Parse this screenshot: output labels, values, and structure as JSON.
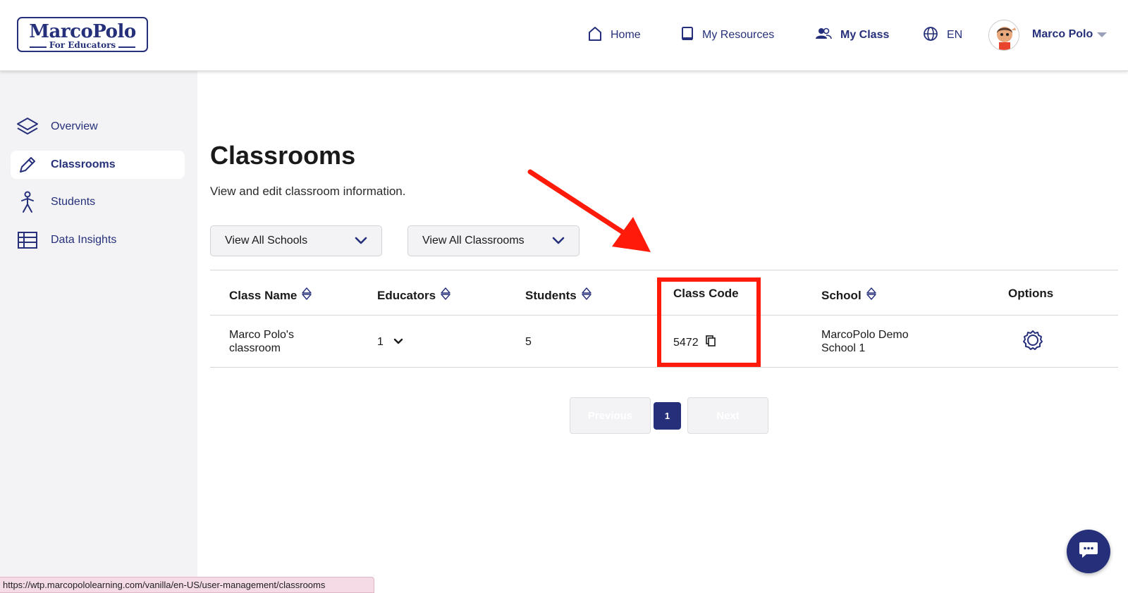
{
  "header": {
    "logo_text": "MarcoPolo",
    "logo_subtext": "For Educators",
    "nav": [
      {
        "label": "Home",
        "icon": "home-icon"
      },
      {
        "label": "My Resources",
        "icon": "book-icon"
      },
      {
        "label": "My Class",
        "icon": "people-icon",
        "active": true
      },
      {
        "label": "EN",
        "icon": "globe-icon"
      }
    ],
    "user_name": "Marco Polo"
  },
  "sidebar": {
    "items": [
      {
        "label": "Overview",
        "icon": "layers-icon"
      },
      {
        "label": "Classrooms",
        "icon": "pencil-icon",
        "active": true
      },
      {
        "label": "Students",
        "icon": "person-icon"
      },
      {
        "label": "Data Insights",
        "icon": "table-icon"
      }
    ]
  },
  "main": {
    "title": "Classrooms",
    "subtitle": "View and edit classroom information.",
    "filters": {
      "school": "View All Schools",
      "classroom": "View All Classrooms"
    },
    "table": {
      "columns": [
        "Class Name",
        "Educators",
        "Students",
        "Class Code",
        "School",
        "Options"
      ],
      "rows": [
        {
          "class_name_line1": "Marco Polo's",
          "class_name_line2": "classroom",
          "educators": "1",
          "students": "5",
          "class_code": "5472",
          "school_line1": "MarcoPolo Demo",
          "school_line2": "School 1"
        }
      ]
    },
    "pagination": {
      "previous": "Previous",
      "current": "1",
      "next": "Next"
    }
  },
  "status_bar": {
    "url": "https://wtp.marcopololearning.com/vanilla/en-US/user-management/classrooms"
  },
  "colors": {
    "brand": "#26307a",
    "highlight": "#ff1a0a",
    "sidebar_bg": "#f3f3f5"
  }
}
